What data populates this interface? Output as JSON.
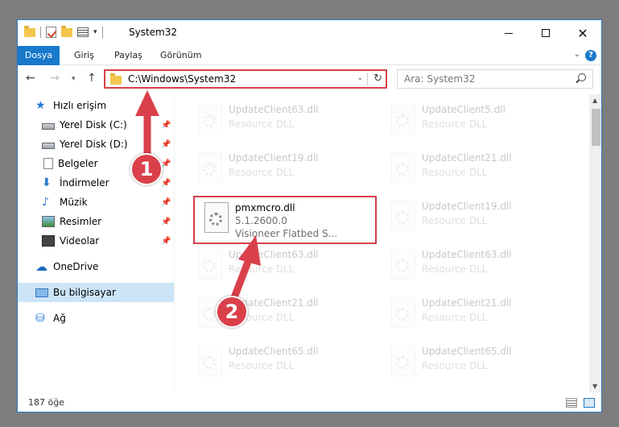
{
  "window": {
    "title": "System32"
  },
  "ribbon": {
    "tabs": [
      "Dosya",
      "Giriş",
      "Paylaş",
      "Görünüm"
    ]
  },
  "navbar": {
    "address": "C:\\Windows\\System32",
    "search_placeholder": "Ara: System32"
  },
  "sidebar": {
    "items": [
      {
        "label": "Hızlı erişim",
        "icon": "star-icon"
      },
      {
        "label": "Yerel Disk (C:)",
        "icon": "disk-icon"
      },
      {
        "label": "Yerel Disk (D:)",
        "icon": "disk-icon"
      },
      {
        "label": "Belgeler",
        "icon": "document-icon"
      },
      {
        "label": "İndirmeler",
        "icon": "download-icon"
      },
      {
        "label": "Müzik",
        "icon": "music-icon"
      },
      {
        "label": "Resimler",
        "icon": "pictures-icon"
      },
      {
        "label": "Videolar",
        "icon": "video-icon"
      },
      {
        "label": "OneDrive",
        "icon": "cloud-icon"
      },
      {
        "label": "Bu bilgisayar",
        "icon": "computer-icon"
      },
      {
        "label": "Ağ",
        "icon": "network-icon"
      }
    ]
  },
  "files": [
    {
      "name": "UpdateClient63.dll",
      "desc": "Resource DLL"
    },
    {
      "name": "UpdateClient5.dll",
      "desc": "Resource DLL"
    },
    {
      "name": "UpdateClient19.dll",
      "desc": "Resource DLL"
    },
    {
      "name": "UpdateClient21.dll",
      "desc": "Resource DLL"
    },
    {
      "name": "pmxmcro.dll",
      "version": "5.1.2600.0",
      "desc": "Visioneer Flatbed S..."
    },
    {
      "name": "UpdateClient19.dll",
      "desc": "Resource DLL"
    },
    {
      "name": "UpdateClient63.dll",
      "desc": "Resource DLL"
    },
    {
      "name": "UpdateClient63.dll",
      "desc": "Resource DLL"
    },
    {
      "name": "UpdateClient21.dll",
      "desc": "Resource DLL"
    },
    {
      "name": "UpdateClient21.dll",
      "desc": "Resource DLL"
    },
    {
      "name": "UpdateClient65.dll",
      "desc": "Resource DLL"
    },
    {
      "name": "UpdateClient65.dll",
      "desc": "Resource DLL"
    }
  ],
  "status": {
    "item_count": "187 öğe"
  },
  "annotations": {
    "step1": "1",
    "step2": "2",
    "color": "#d9404a"
  }
}
